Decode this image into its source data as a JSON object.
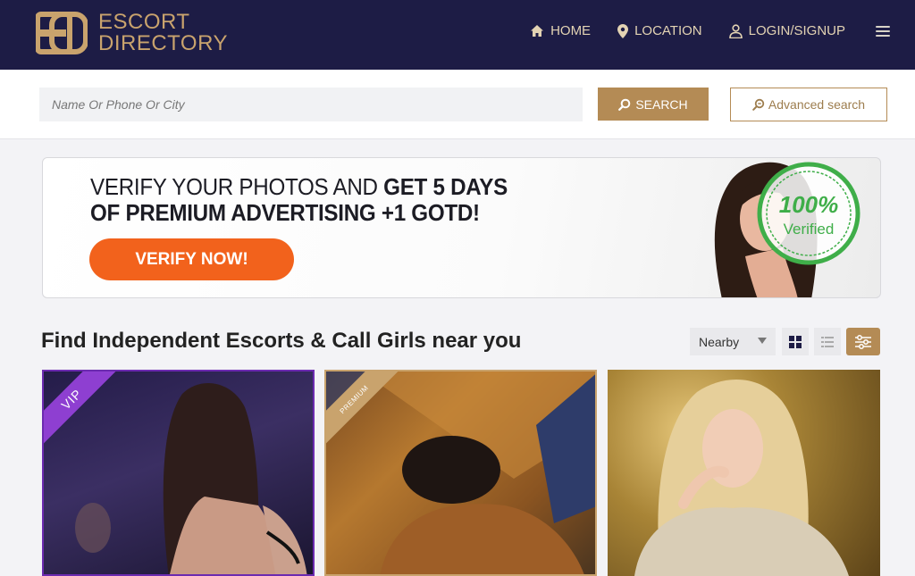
{
  "header": {
    "logo": {
      "line1": "ESCORT",
      "line2": "DIRECTORY"
    },
    "nav": [
      {
        "label": "HOME",
        "icon": "home-icon"
      },
      {
        "label": "LOCATION",
        "icon": "location-pin-icon"
      },
      {
        "label": "LOGIN/SIGNUP",
        "icon": "user-icon"
      }
    ],
    "menu_icon": "hamburger-menu-icon"
  },
  "search": {
    "placeholder": "Name Or Phone Or City",
    "value": "",
    "search_label": "SEARCH",
    "advanced_label": "Advanced search"
  },
  "banner": {
    "line1_regular": "VERIFY YOUR PHOTOS AND ",
    "line1_bold": "GET 5 DAYS",
    "line2": "OF PREMIUM ADVERTISING +1 GOTD!",
    "button": "VERIFY NOW!",
    "seal_top": "100%",
    "seal_bottom": "Verified"
  },
  "listing": {
    "title": "Find Independent Escorts & Call Girls near you",
    "sort_value": "Nearby",
    "view_icons": [
      "grid-view-icon",
      "list-view-icon",
      "filter-sliders-icon"
    ]
  },
  "cards": [
    {
      "badge": "VIP"
    },
    {
      "badge": "PREMIUM"
    },
    {
      "badge": ""
    }
  ],
  "colors": {
    "header_bg": "#1d1c45",
    "accent_gold": "#b48b55",
    "verify_orange": "#f2621c",
    "vip_purple": "#8e3fd1",
    "seal_green": "#3fae49"
  }
}
